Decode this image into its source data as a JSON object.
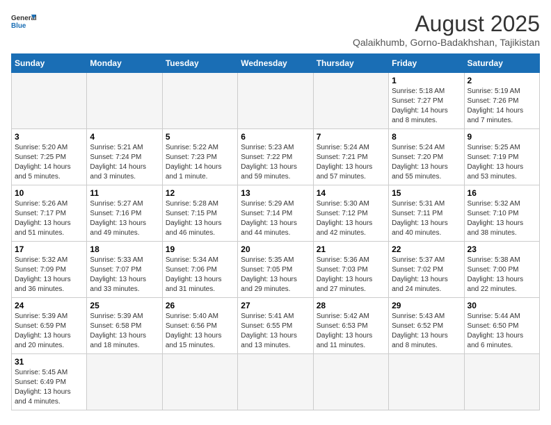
{
  "header": {
    "logo_general": "General",
    "logo_blue": "Blue",
    "month_year": "August 2025",
    "location": "Qalaikhumb, Gorno-Badakhshan, Tajikistan"
  },
  "weekdays": [
    "Sunday",
    "Monday",
    "Tuesday",
    "Wednesday",
    "Thursday",
    "Friday",
    "Saturday"
  ],
  "weeks": [
    [
      {
        "day": "",
        "empty": true
      },
      {
        "day": "",
        "empty": true
      },
      {
        "day": "",
        "empty": true
      },
      {
        "day": "",
        "empty": true
      },
      {
        "day": "",
        "empty": true
      },
      {
        "day": "1",
        "sunrise": "Sunrise: 5:18 AM",
        "sunset": "Sunset: 7:27 PM",
        "daylight": "Daylight: 14 hours and 8 minutes."
      },
      {
        "day": "2",
        "sunrise": "Sunrise: 5:19 AM",
        "sunset": "Sunset: 7:26 PM",
        "daylight": "Daylight: 14 hours and 7 minutes."
      }
    ],
    [
      {
        "day": "3",
        "sunrise": "Sunrise: 5:20 AM",
        "sunset": "Sunset: 7:25 PM",
        "daylight": "Daylight: 14 hours and 5 minutes."
      },
      {
        "day": "4",
        "sunrise": "Sunrise: 5:21 AM",
        "sunset": "Sunset: 7:24 PM",
        "daylight": "Daylight: 14 hours and 3 minutes."
      },
      {
        "day": "5",
        "sunrise": "Sunrise: 5:22 AM",
        "sunset": "Sunset: 7:23 PM",
        "daylight": "Daylight: 14 hours and 1 minute."
      },
      {
        "day": "6",
        "sunrise": "Sunrise: 5:23 AM",
        "sunset": "Sunset: 7:22 PM",
        "daylight": "Daylight: 13 hours and 59 minutes."
      },
      {
        "day": "7",
        "sunrise": "Sunrise: 5:24 AM",
        "sunset": "Sunset: 7:21 PM",
        "daylight": "Daylight: 13 hours and 57 minutes."
      },
      {
        "day": "8",
        "sunrise": "Sunrise: 5:24 AM",
        "sunset": "Sunset: 7:20 PM",
        "daylight": "Daylight: 13 hours and 55 minutes."
      },
      {
        "day": "9",
        "sunrise": "Sunrise: 5:25 AM",
        "sunset": "Sunset: 7:19 PM",
        "daylight": "Daylight: 13 hours and 53 minutes."
      }
    ],
    [
      {
        "day": "10",
        "sunrise": "Sunrise: 5:26 AM",
        "sunset": "Sunset: 7:17 PM",
        "daylight": "Daylight: 13 hours and 51 minutes."
      },
      {
        "day": "11",
        "sunrise": "Sunrise: 5:27 AM",
        "sunset": "Sunset: 7:16 PM",
        "daylight": "Daylight: 13 hours and 49 minutes."
      },
      {
        "day": "12",
        "sunrise": "Sunrise: 5:28 AM",
        "sunset": "Sunset: 7:15 PM",
        "daylight": "Daylight: 13 hours and 46 minutes."
      },
      {
        "day": "13",
        "sunrise": "Sunrise: 5:29 AM",
        "sunset": "Sunset: 7:14 PM",
        "daylight": "Daylight: 13 hours and 44 minutes."
      },
      {
        "day": "14",
        "sunrise": "Sunrise: 5:30 AM",
        "sunset": "Sunset: 7:12 PM",
        "daylight": "Daylight: 13 hours and 42 minutes."
      },
      {
        "day": "15",
        "sunrise": "Sunrise: 5:31 AM",
        "sunset": "Sunset: 7:11 PM",
        "daylight": "Daylight: 13 hours and 40 minutes."
      },
      {
        "day": "16",
        "sunrise": "Sunrise: 5:32 AM",
        "sunset": "Sunset: 7:10 PM",
        "daylight": "Daylight: 13 hours and 38 minutes."
      }
    ],
    [
      {
        "day": "17",
        "sunrise": "Sunrise: 5:32 AM",
        "sunset": "Sunset: 7:09 PM",
        "daylight": "Daylight: 13 hours and 36 minutes."
      },
      {
        "day": "18",
        "sunrise": "Sunrise: 5:33 AM",
        "sunset": "Sunset: 7:07 PM",
        "daylight": "Daylight: 13 hours and 33 minutes."
      },
      {
        "day": "19",
        "sunrise": "Sunrise: 5:34 AM",
        "sunset": "Sunset: 7:06 PM",
        "daylight": "Daylight: 13 hours and 31 minutes."
      },
      {
        "day": "20",
        "sunrise": "Sunrise: 5:35 AM",
        "sunset": "Sunset: 7:05 PM",
        "daylight": "Daylight: 13 hours and 29 minutes."
      },
      {
        "day": "21",
        "sunrise": "Sunrise: 5:36 AM",
        "sunset": "Sunset: 7:03 PM",
        "daylight": "Daylight: 13 hours and 27 minutes."
      },
      {
        "day": "22",
        "sunrise": "Sunrise: 5:37 AM",
        "sunset": "Sunset: 7:02 PM",
        "daylight": "Daylight: 13 hours and 24 minutes."
      },
      {
        "day": "23",
        "sunrise": "Sunrise: 5:38 AM",
        "sunset": "Sunset: 7:00 PM",
        "daylight": "Daylight: 13 hours and 22 minutes."
      }
    ],
    [
      {
        "day": "24",
        "sunrise": "Sunrise: 5:39 AM",
        "sunset": "Sunset: 6:59 PM",
        "daylight": "Daylight: 13 hours and 20 minutes."
      },
      {
        "day": "25",
        "sunrise": "Sunrise: 5:39 AM",
        "sunset": "Sunset: 6:58 PM",
        "daylight": "Daylight: 13 hours and 18 minutes."
      },
      {
        "day": "26",
        "sunrise": "Sunrise: 5:40 AM",
        "sunset": "Sunset: 6:56 PM",
        "daylight": "Daylight: 13 hours and 15 minutes."
      },
      {
        "day": "27",
        "sunrise": "Sunrise: 5:41 AM",
        "sunset": "Sunset: 6:55 PM",
        "daylight": "Daylight: 13 hours and 13 minutes."
      },
      {
        "day": "28",
        "sunrise": "Sunrise: 5:42 AM",
        "sunset": "Sunset: 6:53 PM",
        "daylight": "Daylight: 13 hours and 11 minutes."
      },
      {
        "day": "29",
        "sunrise": "Sunrise: 5:43 AM",
        "sunset": "Sunset: 6:52 PM",
        "daylight": "Daylight: 13 hours and 8 minutes."
      },
      {
        "day": "30",
        "sunrise": "Sunrise: 5:44 AM",
        "sunset": "Sunset: 6:50 PM",
        "daylight": "Daylight: 13 hours and 6 minutes."
      }
    ],
    [
      {
        "day": "31",
        "sunrise": "Sunrise: 5:45 AM",
        "sunset": "Sunset: 6:49 PM",
        "daylight": "Daylight: 13 hours and 4 minutes."
      },
      {
        "day": "",
        "empty": true
      },
      {
        "day": "",
        "empty": true
      },
      {
        "day": "",
        "empty": true
      },
      {
        "day": "",
        "empty": true
      },
      {
        "day": "",
        "empty": true
      },
      {
        "day": "",
        "empty": true
      }
    ]
  ]
}
